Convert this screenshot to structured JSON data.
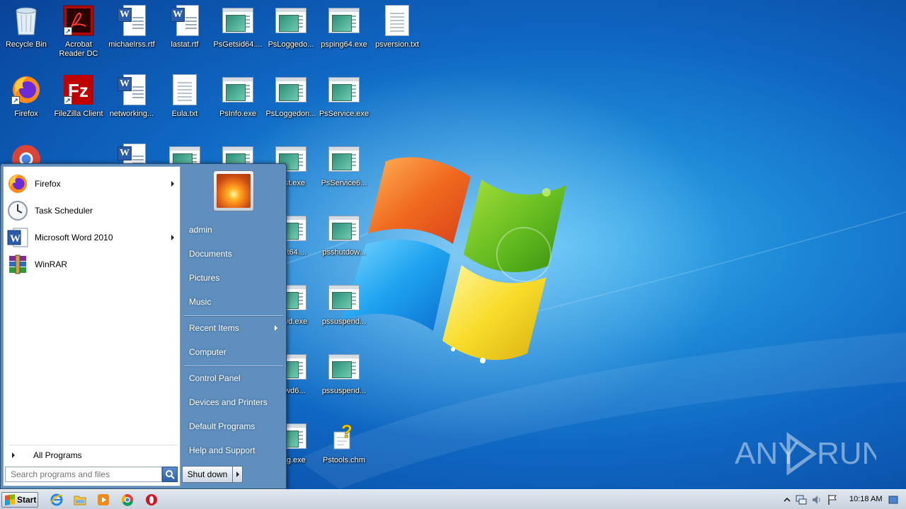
{
  "desktop": {
    "icons": [
      {
        "label": "Recycle Bin"
      },
      {
        "label": "Acrobat Reader DC"
      },
      {
        "label": "michaelrss.rtf"
      },
      {
        "label": "lastat.rtf"
      },
      {
        "label": "PsGetsid64...."
      },
      {
        "label": "PsLoggedo..."
      },
      {
        "label": "psping64.exe"
      },
      {
        "label": "psversion.txt"
      },
      {
        "label": "Firefox"
      },
      {
        "label": "FileZilla Client"
      },
      {
        "label": "networking..."
      },
      {
        "label": "Eula.txt"
      },
      {
        "label": "PsInfo.exe"
      },
      {
        "label": "PsLoggedon..."
      },
      {
        "label": "PsService.exe"
      },
      {
        "label": "plist.exe"
      },
      {
        "label": "PsService6..."
      },
      {
        "label": "plist64...."
      },
      {
        "label": "psshutdow..."
      },
      {
        "label": "pswd.exe"
      },
      {
        "label": "pssuspend..."
      },
      {
        "label": "pswd6..."
      },
      {
        "label": "pssuspend..."
      },
      {
        "label": "ping.exe"
      },
      {
        "label": "Pstools.chm"
      }
    ]
  },
  "start_menu": {
    "programs": [
      {
        "label": "Firefox",
        "icon": "firefox-icon",
        "submenu": true
      },
      {
        "label": "Task Scheduler",
        "icon": "clock-icon",
        "submenu": false
      },
      {
        "label": "Microsoft Word 2010",
        "icon": "word-icon",
        "submenu": true
      },
      {
        "label": "WinRAR",
        "icon": "winrar-icon",
        "submenu": false
      }
    ],
    "all_programs": "All Programs",
    "search_placeholder": "Search programs and files",
    "right": {
      "user": "admin",
      "documents": "Documents",
      "pictures": "Pictures",
      "music": "Music",
      "recent_items": "Recent Items",
      "computer": "Computer",
      "control_panel": "Control Panel",
      "devices_printers": "Devices and Printers",
      "default_programs": "Default Programs",
      "help_support": "Help and Support"
    },
    "shutdown": "Shut down"
  },
  "taskbar": {
    "start_label": "Start",
    "pinned": [
      "internet-explorer-icon",
      "explorer-icon",
      "media-player-icon",
      "chrome-icon",
      "opera-icon"
    ],
    "clock": "10:18 AM"
  },
  "watermark": {
    "text_left": "ANY",
    "text_right": "RUN"
  },
  "colors": {
    "desktop_blue": "#1e8ad8",
    "start_menu_frame": "#5f8fbf",
    "taskbar": "#d4dde7"
  }
}
